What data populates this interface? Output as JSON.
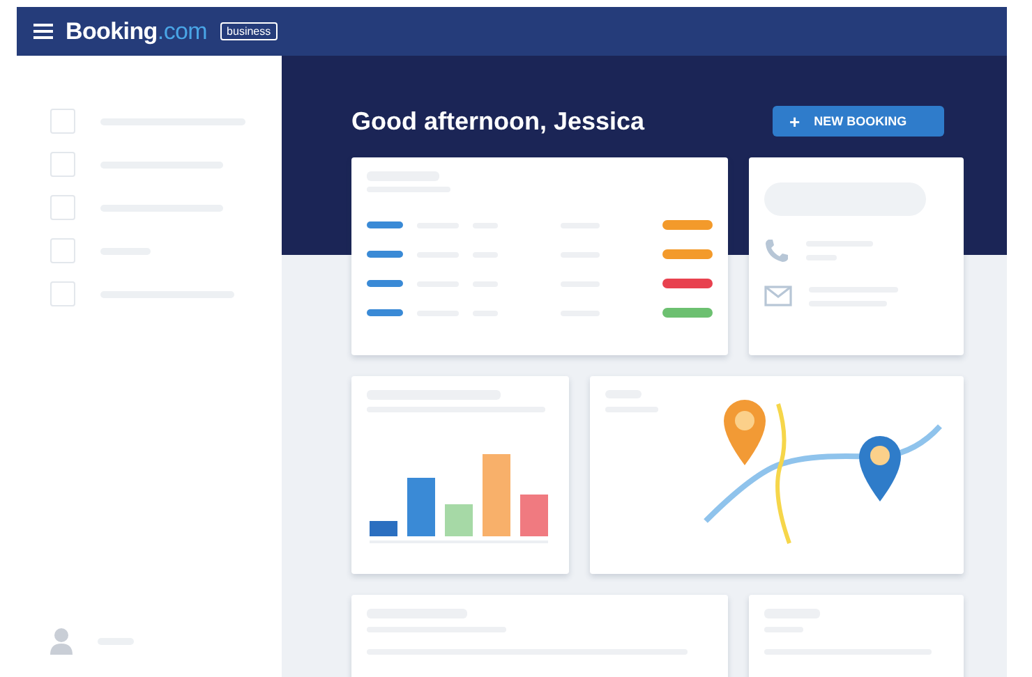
{
  "header": {
    "brand": "Booking",
    "brand_suffix": ".com",
    "badge": "business"
  },
  "greeting": "Good afternoon, Jessica",
  "new_booking_button": {
    "icon": "+",
    "label": "NEW BOOKING"
  },
  "bookings": [
    {
      "color": "#f39a2b"
    },
    {
      "color": "#f39a2b"
    },
    {
      "color": "#e8414f"
    },
    {
      "color": "#6cc070"
    }
  ]
}
